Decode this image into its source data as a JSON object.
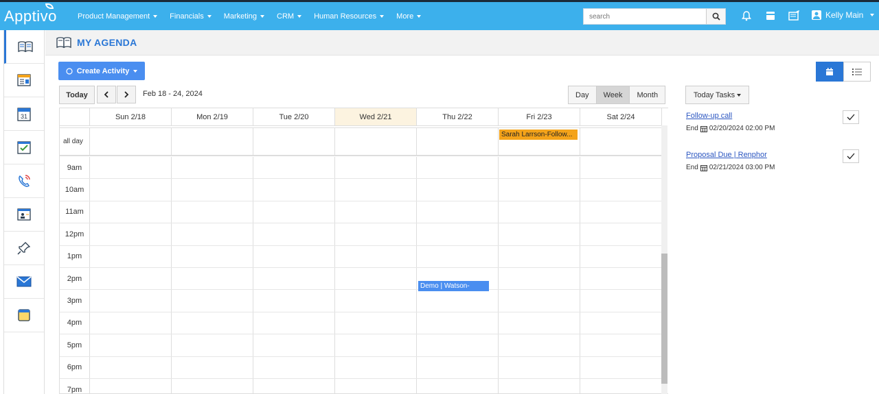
{
  "app": {
    "logo": "Apptivo"
  },
  "nav": {
    "items": [
      {
        "label": "Product Management"
      },
      {
        "label": "Financials"
      },
      {
        "label": "Marketing"
      },
      {
        "label": "CRM"
      },
      {
        "label": "Human Resources"
      },
      {
        "label": "More"
      }
    ]
  },
  "search": {
    "placeholder": "search",
    "value": ""
  },
  "user": {
    "name": "Kelly Main"
  },
  "page": {
    "title": "MY AGENDA"
  },
  "toolbar": {
    "create_label": "Create Activity",
    "today_label": "Today",
    "date_range": "Feb 18 - 24, 2024",
    "views": [
      "Day",
      "Week",
      "Month"
    ],
    "selected_view": "Week"
  },
  "calendar": {
    "days": [
      "Sun 2/18",
      "Mon 2/19",
      "Tue 2/20",
      "Wed 2/21",
      "Thu 2/22",
      "Fri 2/23",
      "Sat 2/24"
    ],
    "allday_label": "all day",
    "hours": [
      "9am",
      "10am",
      "11am",
      "12pm",
      "1pm",
      "2pm",
      "3pm",
      "4pm",
      "5pm",
      "6pm",
      "7pm"
    ],
    "events": [
      {
        "title": "Sarah Larrson-Follow...",
        "day": "Fri 2/23",
        "slot": "all day"
      },
      {
        "title": "Demo | Watson-",
        "day": "Thu 2/22",
        "slot": "2pm"
      }
    ]
  },
  "tasks": {
    "header": "Today Tasks",
    "items": [
      {
        "title": "Follow-up call",
        "end_label": "End",
        "end": "02/20/2024 02:00 PM"
      },
      {
        "title": "Proposal Due | Renphor",
        "end_label": "End",
        "end": "02/21/2024 03:00 PM"
      }
    ]
  },
  "colors": {
    "topbar": "#3cb0ec",
    "accent": "#2a77d6",
    "event_orange": "#f4a31a",
    "event_blue": "#4a8ef0"
  }
}
